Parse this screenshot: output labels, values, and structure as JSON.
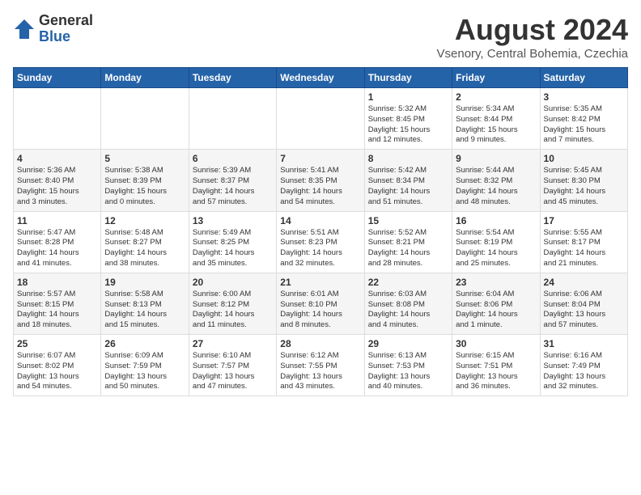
{
  "header": {
    "logo_general": "General",
    "logo_blue": "Blue",
    "month_title": "August 2024",
    "location": "Vsenory, Central Bohemia, Czechia"
  },
  "weekdays": [
    "Sunday",
    "Monday",
    "Tuesday",
    "Wednesday",
    "Thursday",
    "Friday",
    "Saturday"
  ],
  "weeks": [
    [
      {
        "day": "",
        "info": ""
      },
      {
        "day": "",
        "info": ""
      },
      {
        "day": "",
        "info": ""
      },
      {
        "day": "",
        "info": ""
      },
      {
        "day": "1",
        "info": "Sunrise: 5:32 AM\nSunset: 8:45 PM\nDaylight: 15 hours\nand 12 minutes."
      },
      {
        "day": "2",
        "info": "Sunrise: 5:34 AM\nSunset: 8:44 PM\nDaylight: 15 hours\nand 9 minutes."
      },
      {
        "day": "3",
        "info": "Sunrise: 5:35 AM\nSunset: 8:42 PM\nDaylight: 15 hours\nand 7 minutes."
      }
    ],
    [
      {
        "day": "4",
        "info": "Sunrise: 5:36 AM\nSunset: 8:40 PM\nDaylight: 15 hours\nand 3 minutes."
      },
      {
        "day": "5",
        "info": "Sunrise: 5:38 AM\nSunset: 8:39 PM\nDaylight: 15 hours\nand 0 minutes."
      },
      {
        "day": "6",
        "info": "Sunrise: 5:39 AM\nSunset: 8:37 PM\nDaylight: 14 hours\nand 57 minutes."
      },
      {
        "day": "7",
        "info": "Sunrise: 5:41 AM\nSunset: 8:35 PM\nDaylight: 14 hours\nand 54 minutes."
      },
      {
        "day": "8",
        "info": "Sunrise: 5:42 AM\nSunset: 8:34 PM\nDaylight: 14 hours\nand 51 minutes."
      },
      {
        "day": "9",
        "info": "Sunrise: 5:44 AM\nSunset: 8:32 PM\nDaylight: 14 hours\nand 48 minutes."
      },
      {
        "day": "10",
        "info": "Sunrise: 5:45 AM\nSunset: 8:30 PM\nDaylight: 14 hours\nand 45 minutes."
      }
    ],
    [
      {
        "day": "11",
        "info": "Sunrise: 5:47 AM\nSunset: 8:28 PM\nDaylight: 14 hours\nand 41 minutes."
      },
      {
        "day": "12",
        "info": "Sunrise: 5:48 AM\nSunset: 8:27 PM\nDaylight: 14 hours\nand 38 minutes."
      },
      {
        "day": "13",
        "info": "Sunrise: 5:49 AM\nSunset: 8:25 PM\nDaylight: 14 hours\nand 35 minutes."
      },
      {
        "day": "14",
        "info": "Sunrise: 5:51 AM\nSunset: 8:23 PM\nDaylight: 14 hours\nand 32 minutes."
      },
      {
        "day": "15",
        "info": "Sunrise: 5:52 AM\nSunset: 8:21 PM\nDaylight: 14 hours\nand 28 minutes."
      },
      {
        "day": "16",
        "info": "Sunrise: 5:54 AM\nSunset: 8:19 PM\nDaylight: 14 hours\nand 25 minutes."
      },
      {
        "day": "17",
        "info": "Sunrise: 5:55 AM\nSunset: 8:17 PM\nDaylight: 14 hours\nand 21 minutes."
      }
    ],
    [
      {
        "day": "18",
        "info": "Sunrise: 5:57 AM\nSunset: 8:15 PM\nDaylight: 14 hours\nand 18 minutes."
      },
      {
        "day": "19",
        "info": "Sunrise: 5:58 AM\nSunset: 8:13 PM\nDaylight: 14 hours\nand 15 minutes."
      },
      {
        "day": "20",
        "info": "Sunrise: 6:00 AM\nSunset: 8:12 PM\nDaylight: 14 hours\nand 11 minutes."
      },
      {
        "day": "21",
        "info": "Sunrise: 6:01 AM\nSunset: 8:10 PM\nDaylight: 14 hours\nand 8 minutes."
      },
      {
        "day": "22",
        "info": "Sunrise: 6:03 AM\nSunset: 8:08 PM\nDaylight: 14 hours\nand 4 minutes."
      },
      {
        "day": "23",
        "info": "Sunrise: 6:04 AM\nSunset: 8:06 PM\nDaylight: 14 hours\nand 1 minute."
      },
      {
        "day": "24",
        "info": "Sunrise: 6:06 AM\nSunset: 8:04 PM\nDaylight: 13 hours\nand 57 minutes."
      }
    ],
    [
      {
        "day": "25",
        "info": "Sunrise: 6:07 AM\nSunset: 8:02 PM\nDaylight: 13 hours\nand 54 minutes."
      },
      {
        "day": "26",
        "info": "Sunrise: 6:09 AM\nSunset: 7:59 PM\nDaylight: 13 hours\nand 50 minutes."
      },
      {
        "day": "27",
        "info": "Sunrise: 6:10 AM\nSunset: 7:57 PM\nDaylight: 13 hours\nand 47 minutes."
      },
      {
        "day": "28",
        "info": "Sunrise: 6:12 AM\nSunset: 7:55 PM\nDaylight: 13 hours\nand 43 minutes."
      },
      {
        "day": "29",
        "info": "Sunrise: 6:13 AM\nSunset: 7:53 PM\nDaylight: 13 hours\nand 40 minutes."
      },
      {
        "day": "30",
        "info": "Sunrise: 6:15 AM\nSunset: 7:51 PM\nDaylight: 13 hours\nand 36 minutes."
      },
      {
        "day": "31",
        "info": "Sunrise: 6:16 AM\nSunset: 7:49 PM\nDaylight: 13 hours\nand 32 minutes."
      }
    ]
  ]
}
